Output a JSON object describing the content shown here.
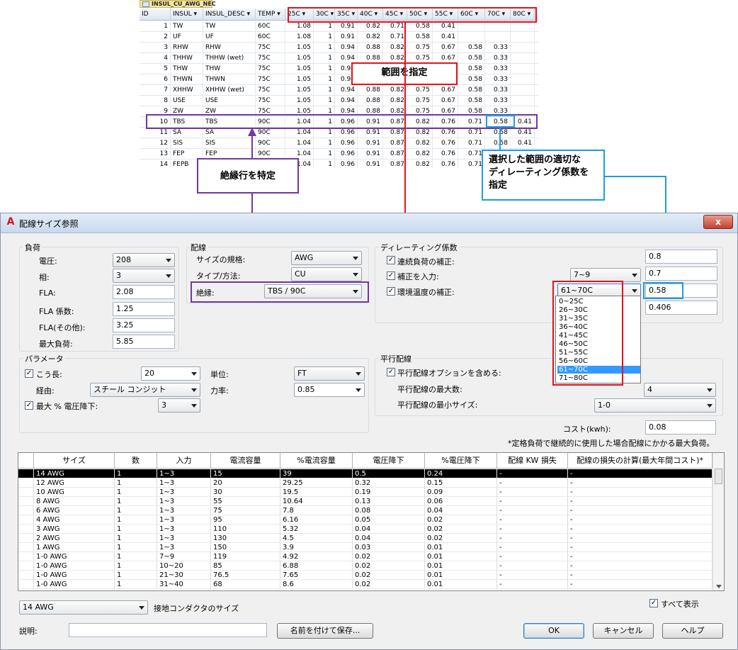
{
  "db": {
    "tab_title": "INSUL_CU_AWG_NEC",
    "columns": [
      "ID",
      "INSUL",
      "INSUL_DESC",
      "TEMP",
      "25C",
      "30C",
      "35C",
      "40C",
      "45C",
      "50C",
      "55C",
      "60C",
      "70C",
      "80C"
    ],
    "rows": [
      [
        "1",
        "TW",
        "TW",
        "60C",
        "1.08",
        "1",
        "0.91",
        "0.82",
        "0.71",
        "0.58",
        "0.41",
        "",
        "",
        ""
      ],
      [
        "2",
        "UF",
        "UF",
        "60C",
        "1.08",
        "1",
        "0.91",
        "0.82",
        "0.71",
        "0.58",
        "0.41",
        "",
        "",
        ""
      ],
      [
        "3",
        "RHW",
        "RHW",
        "75C",
        "1.05",
        "1",
        "0.94",
        "0.88",
        "0.82",
        "0.75",
        "0.67",
        "0.58",
        "0.33",
        ""
      ],
      [
        "4",
        "THHW",
        "THHW (wet)",
        "75C",
        "1.05",
        "1",
        "0.94",
        "0.88",
        "0.82",
        "0.75",
        "0.67",
        "0.58",
        "0.33",
        ""
      ],
      [
        "5",
        "THW",
        "THW",
        "75C",
        "1.05",
        "1",
        "0.94",
        "0.88",
        "0.82",
        "0.75",
        "0.67",
        "0.58",
        "0.33",
        ""
      ],
      [
        "6",
        "THWN",
        "THWN",
        "75C",
        "1.05",
        "1",
        "0.94",
        "0.88",
        "0.82",
        "0.75",
        "0.67",
        "0.58",
        "0.33",
        ""
      ],
      [
        "7",
        "XHHW",
        "XHHW (wet)",
        "75C",
        "1.05",
        "1",
        "0.94",
        "0.88",
        "0.82",
        "0.75",
        "0.67",
        "0.58",
        "0.33",
        ""
      ],
      [
        "8",
        "USE",
        "USE",
        "75C",
        "1.05",
        "1",
        "0.94",
        "0.88",
        "0.82",
        "0.75",
        "0.67",
        "0.58",
        "0.33",
        ""
      ],
      [
        "9",
        "ZW",
        "ZW",
        "75C",
        "1.05",
        "1",
        "0.94",
        "0.88",
        "0.82",
        "0.75",
        "0.67",
        "0.58",
        "0.33",
        ""
      ],
      [
        "10",
        "TBS",
        "TBS",
        "90C",
        "1.04",
        "1",
        "0.96",
        "0.91",
        "0.87",
        "0.82",
        "0.76",
        "0.71",
        "0.58",
        "0.41"
      ],
      [
        "11",
        "SA",
        "SA",
        "90C",
        "1.04",
        "1",
        "0.96",
        "0.91",
        "0.87",
        "0.82",
        "0.76",
        "0.71",
        "0.58",
        "0.41"
      ],
      [
        "12",
        "SIS",
        "SIS",
        "90C",
        "1.04",
        "1",
        "0.96",
        "0.91",
        "0.87",
        "0.82",
        "0.76",
        "0.71",
        "0.58",
        "0.41"
      ],
      [
        "13",
        "FEP",
        "FEP",
        "90C",
        "1.04",
        "1",
        "0.96",
        "0.91",
        "0.87",
        "0.82",
        "0.76",
        "0.71",
        "0.58",
        "0.41"
      ],
      [
        "14",
        "FEPB",
        "FEPB",
        "90C",
        "1.04",
        "1",
        "0.96",
        "0.91",
        "0.87",
        "0.82",
        "0.76",
        "0.71",
        "0.58",
        "0.41"
      ]
    ]
  },
  "annotations": {
    "range": "範囲を指定",
    "row": "絶縁行を特定",
    "factor": "選択した範囲の適切な\nディレーティング係数を\n指定",
    "colors": {
      "red": "#e8101a",
      "blue": "#1e9be6",
      "purple": "#7038a0"
    }
  },
  "dialog": {
    "title": "配線サイズ参照",
    "app_icon": "A",
    "close": "x",
    "load": {
      "group": "負荷",
      "voltage_label": "電圧:",
      "voltage": "208",
      "phase_label": "相:",
      "phase": "3",
      "fla_label": "FLA:",
      "fla": "2.08",
      "fla_factor_label": "FLA 係数:",
      "fla_factor": "1.25",
      "fla_other_label": "FLA(その他):",
      "fla_other": "3.25",
      "max_load_label": "最大負荷:",
      "max_load": "5.85"
    },
    "wiring": {
      "group": "配線",
      "standard_label": "サイズの規格:",
      "standard": "AWG",
      "type_label": "タイプ/方法:",
      "type": "CU",
      "insulation_label": "絶縁:",
      "insulation": "TBS / 90C"
    },
    "derating": {
      "group": "ディレーティング係数",
      "continuous_label": "連続負荷の補正:",
      "continuous": "0.8",
      "input_label": "補正を入力:",
      "input_select": "7~9",
      "input_value": "0.7",
      "ambient_label": "環境温度の補正:",
      "ambient_select": "61~70C",
      "ambient_value": "0.58",
      "fourth_value": "0.406",
      "options": [
        "0~25C",
        "26~30C",
        "31~35C",
        "36~40C",
        "41~45C",
        "46~50C",
        "51~55C",
        "56~60C",
        "61~70C",
        "71~80C"
      ],
      "selected_index": 8
    },
    "params": {
      "group": "パラメータ",
      "length_label": "こう長:",
      "length": "20",
      "route_label": "経由:",
      "route": "スチール コンジット",
      "vdrop_label": "最大 % 電圧降下:",
      "vdrop": "3",
      "unit_label": "単位:",
      "unit": "FT",
      "pf_label": "力率:",
      "pf": "0.85"
    },
    "parallel": {
      "group": "平行配線",
      "include_label": "平行配線オプションを含める:",
      "max_label": "平行配線の最大数:",
      "max": "4",
      "min_size_label": "平行配線の最小サイズ:",
      "min_size": "1-0"
    },
    "cost_label": "コスト(kwh):",
    "cost": "0.08",
    "footnote": "*定格負荷で継続的に使用した場合配線にかかる最大負荷。",
    "grid": {
      "headers": [
        "サイズ",
        "数",
        "入力",
        "電流容量",
        "%電流容量",
        "電圧降下",
        "%電圧降下",
        "配線 KW 損失",
        "配線の損失の計算(最大年間コスト)*"
      ],
      "rows": [
        [
          "14 AWG",
          "1",
          "1~3",
          "15",
          "39",
          "0.5",
          "0.24",
          "-",
          "-"
        ],
        [
          "12 AWG",
          "1",
          "1~3",
          "20",
          "29.25",
          "0.32",
          "0.15",
          "-",
          "-"
        ],
        [
          "10 AWG",
          "1",
          "1~3",
          "30",
          "19.5",
          "0.19",
          "0.09",
          "-",
          "-"
        ],
        [
          "8 AWG",
          "1",
          "1~3",
          "55",
          "10.64",
          "0.13",
          "0.06",
          "-",
          "-"
        ],
        [
          "6 AWG",
          "1",
          "1~3",
          "75",
          "7.8",
          "0.08",
          "0.04",
          "-",
          "-"
        ],
        [
          "4 AWG",
          "1",
          "1~3",
          "95",
          "6.16",
          "0.05",
          "0.02",
          "-",
          "-"
        ],
        [
          "3 AWG",
          "1",
          "1~3",
          "110",
          "5.32",
          "0.04",
          "0.02",
          "-",
          "-"
        ],
        [
          "2 AWG",
          "1",
          "1~3",
          "130",
          "4.5",
          "0.04",
          "0.02",
          "-",
          "-"
        ],
        [
          "1 AWG",
          "1",
          "1~3",
          "150",
          "3.9",
          "0.03",
          "0.01",
          "-",
          "-"
        ],
        [
          "1-0 AWG",
          "1",
          "7~9",
          "119",
          "4.92",
          "0.02",
          "0.01",
          "-",
          "-"
        ],
        [
          "1-0 AWG",
          "1",
          "10~20",
          "85",
          "6.88",
          "0.02",
          "0.01",
          "-",
          "-"
        ],
        [
          "1-0 AWG",
          "1",
          "21~30",
          "76.5",
          "7.65",
          "0.02",
          "0.01",
          "-",
          "-"
        ],
        [
          "1-0 AWG",
          "1",
          "31~40",
          "68",
          "8.6",
          "0.02",
          "0.01",
          "-",
          "-"
        ]
      ]
    },
    "ground_select": "14 AWG",
    "ground_label": "接地コンダクタのサイズ",
    "show_all_label": "すべて表示",
    "description_label": "説明:",
    "save_named": "名前を付けて保存...",
    "ok": "OK",
    "cancel": "キャンセル",
    "help": "ヘルプ"
  }
}
